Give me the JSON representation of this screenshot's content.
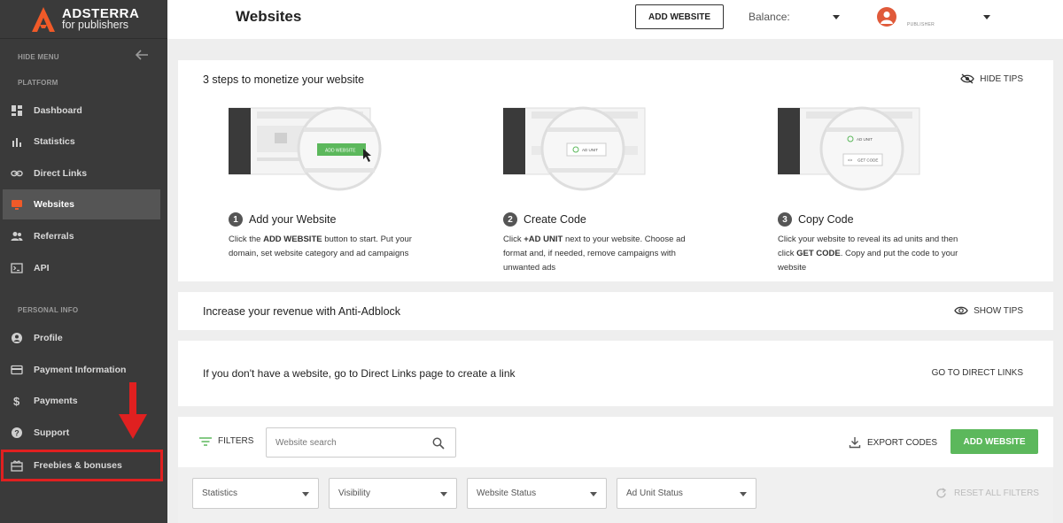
{
  "brand": {
    "name": "ADSTERRA",
    "tagline": "for publishers",
    "accent": "#f05a28"
  },
  "sidebar": {
    "hide_menu": "HIDE MENU",
    "section_platform": "PLATFORM",
    "section_personal": "PERSONAL INFO",
    "items": [
      {
        "label": "Dashboard",
        "icon": "dashboard-icon"
      },
      {
        "label": "Statistics",
        "icon": "bar-chart-icon"
      },
      {
        "label": "Direct Links",
        "icon": "link-icon"
      },
      {
        "label": "Websites",
        "icon": "monitor-icon",
        "active": true
      },
      {
        "label": "Referrals",
        "icon": "people-icon"
      },
      {
        "label": "API",
        "icon": "terminal-icon"
      },
      {
        "label": "Profile",
        "icon": "account-icon"
      },
      {
        "label": "Payment Information",
        "icon": "credit-card-icon"
      },
      {
        "label": "Payments",
        "icon": "dollar-icon"
      },
      {
        "label": "Support",
        "icon": "help-icon"
      },
      {
        "label": "Freebies & bonuses",
        "icon": "gift-icon"
      }
    ]
  },
  "header": {
    "title": "Websites",
    "add_website": "ADD WEBSITE",
    "balance_label": "Balance:",
    "user_role": "PUBLISHER"
  },
  "tips": {
    "title": "3 steps to monetize your website",
    "hide_tips": "HIDE TIPS",
    "steps": [
      {
        "num": "1",
        "title": "Add your Website",
        "t1": "Click the ",
        "b1": "ADD WEBSITE",
        "t2": " button to start. Put your domain, set website category and ad campaigns",
        "b2": "",
        "t3": "",
        "img_button": "ADD WEBSITE"
      },
      {
        "num": "2",
        "title": "Create Code",
        "t1": "Click ",
        "b1": "+AD UNIT",
        "t2": " next to your website. Choose ad format and, if needed, remove campaigns with unwanted ads",
        "b2": "",
        "t3": "",
        "img_button": "AD UNIT"
      },
      {
        "num": "3",
        "title": "Copy Code",
        "t1": "Click your website to reveal its ad units and then click ",
        "b1": "GET CODE",
        "t2": ". Copy and put the code to your website",
        "b2": "",
        "t3": "",
        "img_button": "AD UNIT",
        "img_button2": "GET CODE"
      }
    ]
  },
  "antiadblock": {
    "title": "Increase your revenue with Anti-Adblock",
    "show_tips": "SHOW TIPS"
  },
  "direct_links": {
    "text": "If you don't have a website, go to Direct Links page to create a link",
    "link": "GO TO DIRECT LINKS"
  },
  "filters": {
    "label": "FILTERS",
    "search_placeholder": "Website search",
    "export": "EXPORT CODES",
    "add_website": "ADD WEBSITE",
    "selects": [
      "Statistics",
      "Visibility",
      "Website Status",
      "Ad Unit Status"
    ],
    "reset": "RESET ALL FILTERS"
  },
  "colors": {
    "sidebar": "#3a3a3a",
    "green": "#5cb85c",
    "highlight": "#e02020"
  }
}
